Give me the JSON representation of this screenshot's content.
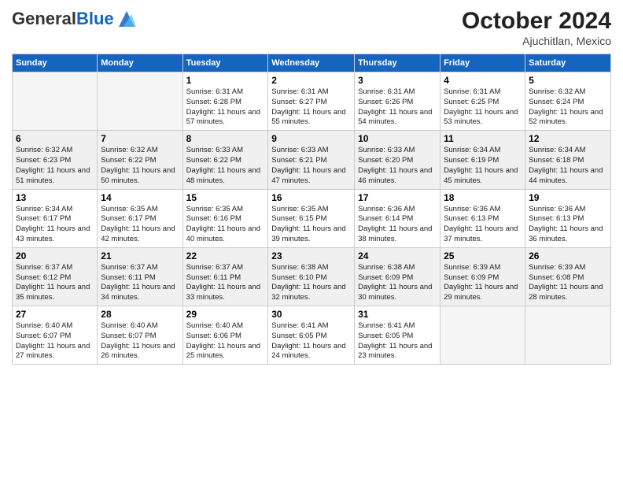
{
  "header": {
    "logo": {
      "general": "General",
      "blue": "Blue"
    },
    "month_year": "October 2024",
    "location": "Ajuchitlan, Mexico"
  },
  "weekdays": [
    "Sunday",
    "Monday",
    "Tuesday",
    "Wednesday",
    "Thursday",
    "Friday",
    "Saturday"
  ],
  "weeks": [
    [
      {
        "day": null
      },
      {
        "day": null
      },
      {
        "day": "1",
        "sunrise": "Sunrise: 6:31 AM",
        "sunset": "Sunset: 6:28 PM",
        "daylight": "Daylight: 11 hours and 57 minutes."
      },
      {
        "day": "2",
        "sunrise": "Sunrise: 6:31 AM",
        "sunset": "Sunset: 6:27 PM",
        "daylight": "Daylight: 11 hours and 55 minutes."
      },
      {
        "day": "3",
        "sunrise": "Sunrise: 6:31 AM",
        "sunset": "Sunset: 6:26 PM",
        "daylight": "Daylight: 11 hours and 54 minutes."
      },
      {
        "day": "4",
        "sunrise": "Sunrise: 6:31 AM",
        "sunset": "Sunset: 6:25 PM",
        "daylight": "Daylight: 11 hours and 53 minutes."
      },
      {
        "day": "5",
        "sunrise": "Sunrise: 6:32 AM",
        "sunset": "Sunset: 6:24 PM",
        "daylight": "Daylight: 11 hours and 52 minutes."
      }
    ],
    [
      {
        "day": "6",
        "sunrise": "Sunrise: 6:32 AM",
        "sunset": "Sunset: 6:23 PM",
        "daylight": "Daylight: 11 hours and 51 minutes."
      },
      {
        "day": "7",
        "sunrise": "Sunrise: 6:32 AM",
        "sunset": "Sunset: 6:22 PM",
        "daylight": "Daylight: 11 hours and 50 minutes."
      },
      {
        "day": "8",
        "sunrise": "Sunrise: 6:33 AM",
        "sunset": "Sunset: 6:22 PM",
        "daylight": "Daylight: 11 hours and 48 minutes."
      },
      {
        "day": "9",
        "sunrise": "Sunrise: 6:33 AM",
        "sunset": "Sunset: 6:21 PM",
        "daylight": "Daylight: 11 hours and 47 minutes."
      },
      {
        "day": "10",
        "sunrise": "Sunrise: 6:33 AM",
        "sunset": "Sunset: 6:20 PM",
        "daylight": "Daylight: 11 hours and 46 minutes."
      },
      {
        "day": "11",
        "sunrise": "Sunrise: 6:34 AM",
        "sunset": "Sunset: 6:19 PM",
        "daylight": "Daylight: 11 hours and 45 minutes."
      },
      {
        "day": "12",
        "sunrise": "Sunrise: 6:34 AM",
        "sunset": "Sunset: 6:18 PM",
        "daylight": "Daylight: 11 hours and 44 minutes."
      }
    ],
    [
      {
        "day": "13",
        "sunrise": "Sunrise: 6:34 AM",
        "sunset": "Sunset: 6:17 PM",
        "daylight": "Daylight: 11 hours and 43 minutes."
      },
      {
        "day": "14",
        "sunrise": "Sunrise: 6:35 AM",
        "sunset": "Sunset: 6:17 PM",
        "daylight": "Daylight: 11 hours and 42 minutes."
      },
      {
        "day": "15",
        "sunrise": "Sunrise: 6:35 AM",
        "sunset": "Sunset: 6:16 PM",
        "daylight": "Daylight: 11 hours and 40 minutes."
      },
      {
        "day": "16",
        "sunrise": "Sunrise: 6:35 AM",
        "sunset": "Sunset: 6:15 PM",
        "daylight": "Daylight: 11 hours and 39 minutes."
      },
      {
        "day": "17",
        "sunrise": "Sunrise: 6:36 AM",
        "sunset": "Sunset: 6:14 PM",
        "daylight": "Daylight: 11 hours and 38 minutes."
      },
      {
        "day": "18",
        "sunrise": "Sunrise: 6:36 AM",
        "sunset": "Sunset: 6:13 PM",
        "daylight": "Daylight: 11 hours and 37 minutes."
      },
      {
        "day": "19",
        "sunrise": "Sunrise: 6:36 AM",
        "sunset": "Sunset: 6:13 PM",
        "daylight": "Daylight: 11 hours and 36 minutes."
      }
    ],
    [
      {
        "day": "20",
        "sunrise": "Sunrise: 6:37 AM",
        "sunset": "Sunset: 6:12 PM",
        "daylight": "Daylight: 11 hours and 35 minutes."
      },
      {
        "day": "21",
        "sunrise": "Sunrise: 6:37 AM",
        "sunset": "Sunset: 6:11 PM",
        "daylight": "Daylight: 11 hours and 34 minutes."
      },
      {
        "day": "22",
        "sunrise": "Sunrise: 6:37 AM",
        "sunset": "Sunset: 6:11 PM",
        "daylight": "Daylight: 11 hours and 33 minutes."
      },
      {
        "day": "23",
        "sunrise": "Sunrise: 6:38 AM",
        "sunset": "Sunset: 6:10 PM",
        "daylight": "Daylight: 11 hours and 32 minutes."
      },
      {
        "day": "24",
        "sunrise": "Sunrise: 6:38 AM",
        "sunset": "Sunset: 6:09 PM",
        "daylight": "Daylight: 11 hours and 30 minutes."
      },
      {
        "day": "25",
        "sunrise": "Sunrise: 6:39 AM",
        "sunset": "Sunset: 6:09 PM",
        "daylight": "Daylight: 11 hours and 29 minutes."
      },
      {
        "day": "26",
        "sunrise": "Sunrise: 6:39 AM",
        "sunset": "Sunset: 6:08 PM",
        "daylight": "Daylight: 11 hours and 28 minutes."
      }
    ],
    [
      {
        "day": "27",
        "sunrise": "Sunrise: 6:40 AM",
        "sunset": "Sunset: 6:07 PM",
        "daylight": "Daylight: 11 hours and 27 minutes."
      },
      {
        "day": "28",
        "sunrise": "Sunrise: 6:40 AM",
        "sunset": "Sunset: 6:07 PM",
        "daylight": "Daylight: 11 hours and 26 minutes."
      },
      {
        "day": "29",
        "sunrise": "Sunrise: 6:40 AM",
        "sunset": "Sunset: 6:06 PM",
        "daylight": "Daylight: 11 hours and 25 minutes."
      },
      {
        "day": "30",
        "sunrise": "Sunrise: 6:41 AM",
        "sunset": "Sunset: 6:05 PM",
        "daylight": "Daylight: 11 hours and 24 minutes."
      },
      {
        "day": "31",
        "sunrise": "Sunrise: 6:41 AM",
        "sunset": "Sunset: 6:05 PM",
        "daylight": "Daylight: 11 hours and 23 minutes."
      },
      {
        "day": null
      },
      {
        "day": null
      }
    ]
  ]
}
